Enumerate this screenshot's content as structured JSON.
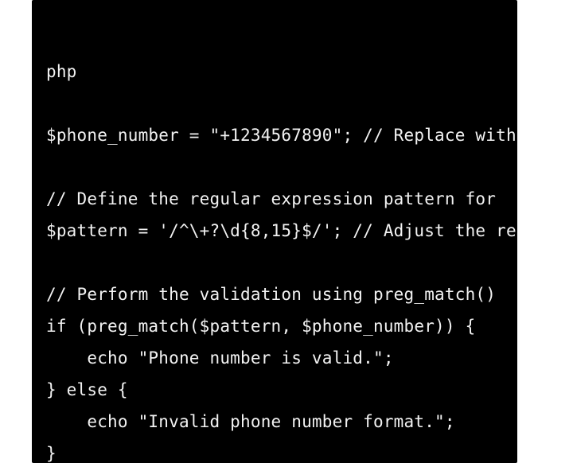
{
  "code": {
    "language": "php",
    "lines": [
      "php",
      "",
      "$phone_number = \"+1234567890\"; // Replace with",
      "",
      "// Define the regular expression pattern for ",
      "$pattern = '/^\\+?\\d{8,15}$/'; // Adjust the re",
      "",
      "// Perform the validation using preg_match()",
      "if (preg_match($pattern, $phone_number)) {",
      "    echo \"Phone number is valid.\";",
      "} else {",
      "    echo \"Invalid phone number format.\";",
      "}"
    ]
  }
}
